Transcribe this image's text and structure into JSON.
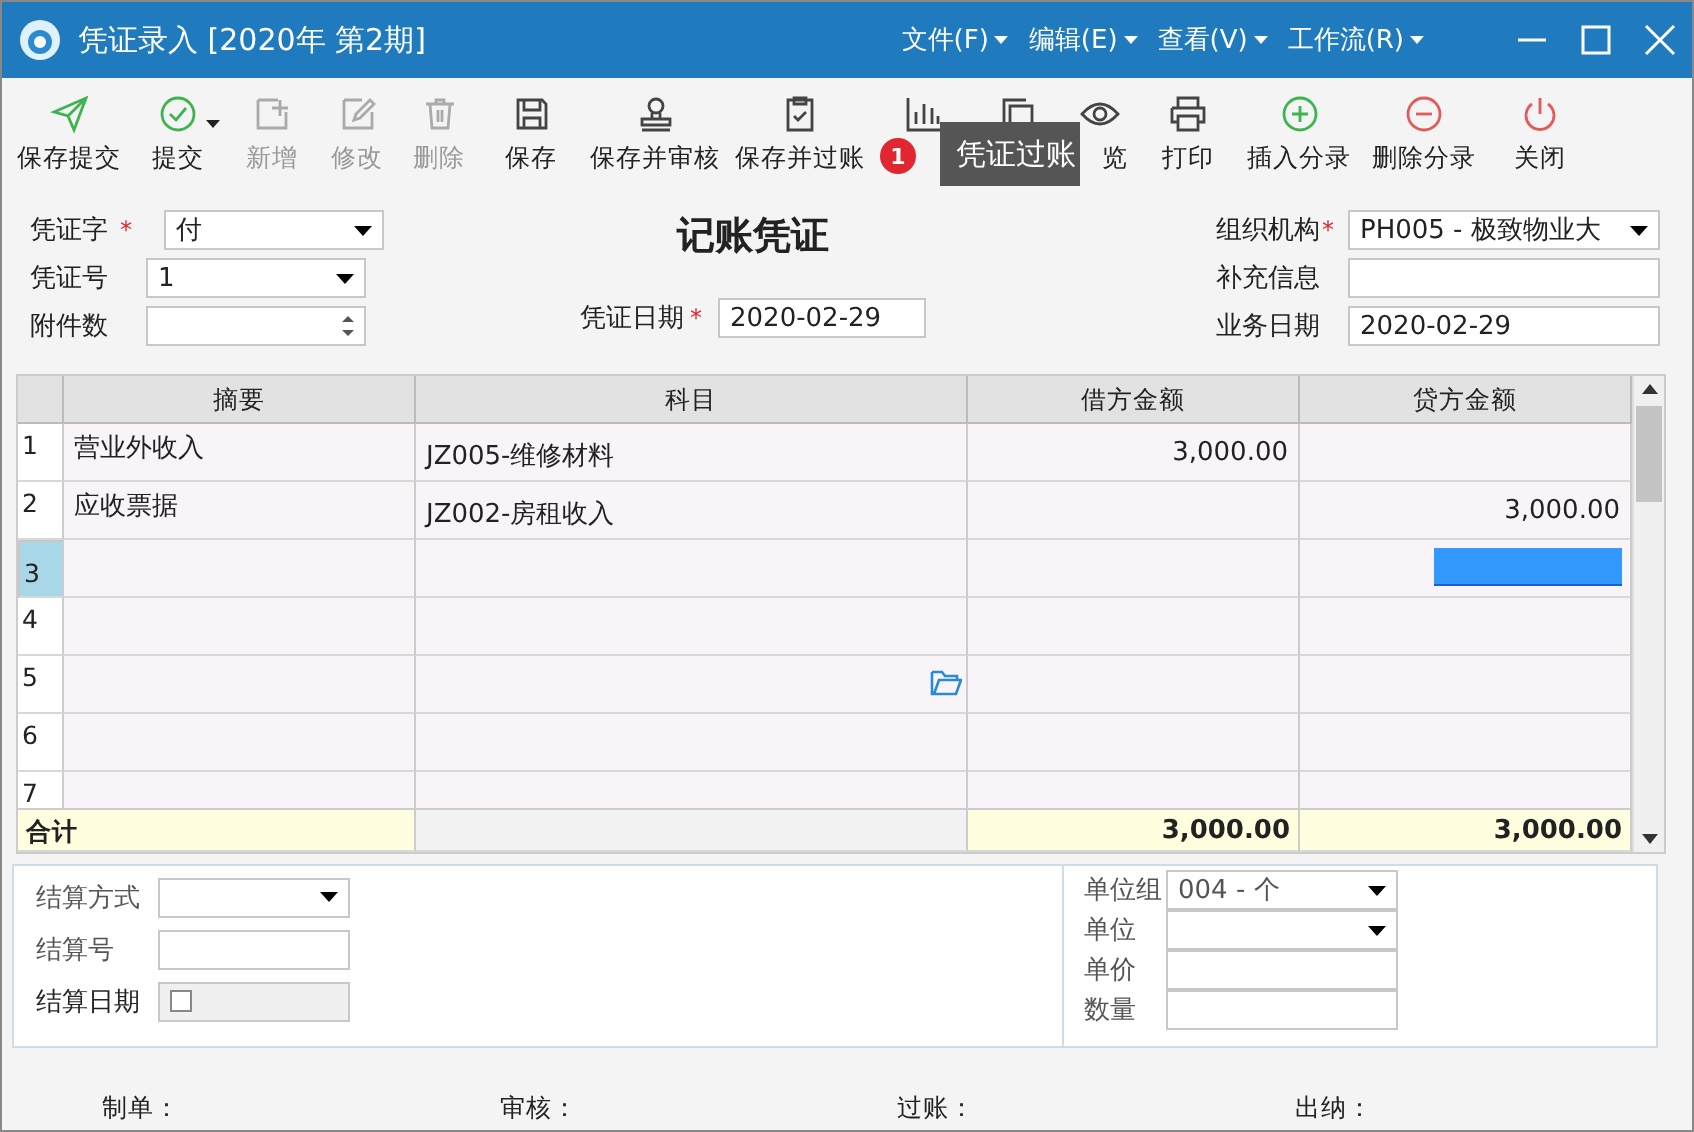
{
  "window": {
    "title": "凭证录入 [2020年 第2期]"
  },
  "menu": [
    {
      "label": "文件(F)"
    },
    {
      "label": "编辑(E)"
    },
    {
      "label": "查看(V)"
    },
    {
      "label": "工作流(R)"
    }
  ],
  "toolbar": [
    {
      "label": "保存提交",
      "disabled": false,
      "has_menu": false
    },
    {
      "label": "提交",
      "disabled": false,
      "has_menu": true
    },
    {
      "label": "新增",
      "disabled": true,
      "has_menu": false
    },
    {
      "label": "修改",
      "disabled": true,
      "has_menu": false
    },
    {
      "label": "删除",
      "disabled": true,
      "has_menu": false
    },
    {
      "label": "保存",
      "disabled": false,
      "has_menu": false
    },
    {
      "label": "保存并审核",
      "disabled": false,
      "has_menu": false
    },
    {
      "label": "保存并过账",
      "disabled": false,
      "has_menu": false
    },
    {
      "disabled": false,
      "has_menu": false
    },
    {
      "disabled": false,
      "has_menu": false
    },
    {
      "label": "览",
      "disabled": false,
      "has_menu": false
    },
    {
      "label": "打印",
      "disabled": false,
      "has_menu": false
    },
    {
      "label": "插入分录",
      "disabled": false,
      "has_menu": false
    },
    {
      "label": "删除分录",
      "disabled": false,
      "has_menu": false
    },
    {
      "label": "关闭",
      "disabled": false,
      "has_menu": false
    }
  ],
  "tooltip": {
    "badge": "1",
    "text": "凭证过账"
  },
  "form": {
    "title": "记账凭证",
    "voucher_type": {
      "label": "凭证字",
      "marker": "*",
      "value": "付"
    },
    "voucher_no": {
      "label": "凭证号",
      "value": "1"
    },
    "attachments": {
      "label": "附件数"
    },
    "voucher_date": {
      "label": "凭证日期",
      "marker": "*",
      "value": "2020-02-29"
    },
    "org": {
      "label": "组织机构",
      "marker": "*",
      "value": "PH005 - 极致物业大"
    },
    "extra": {
      "label": "补充信息"
    },
    "business_date": {
      "label": "业务日期",
      "value": "2020-02-29"
    }
  },
  "table": {
    "columns": [
      "摘要",
      "科目",
      "借方金额",
      "贷方金额"
    ],
    "rows": [
      {
        "no": "1",
        "summary": "营业外收入",
        "account": "JZ005-维修材料",
        "debit": "3,000.00",
        "credit": "",
        "selected": false,
        "lookup": false
      },
      {
        "no": "2",
        "summary": "应收票据",
        "account": "JZ002-房租收入",
        "debit": "",
        "credit": "3,000.00",
        "selected": false,
        "lookup": false
      },
      {
        "no": "3",
        "summary": "",
        "account": "",
        "debit": "",
        "credit": "",
        "selected": true,
        "lookup": false
      },
      {
        "no": "4",
        "summary": "",
        "account": "",
        "debit": "",
        "credit": "",
        "selected": false,
        "lookup": false
      },
      {
        "no": "5",
        "summary": "",
        "account": "",
        "debit": "",
        "credit": "",
        "selected": false,
        "lookup": true
      },
      {
        "no": "6",
        "summary": "",
        "account": "",
        "debit": "",
        "credit": "",
        "selected": false,
        "lookup": false
      },
      {
        "no": "7",
        "summary": "",
        "account": "",
        "debit": "",
        "credit": "",
        "selected": false,
        "lookup": false
      }
    ],
    "total": {
      "label": "合计",
      "debit": "3,000.00",
      "credit": "3,000.00"
    }
  },
  "settlement": {
    "method": {
      "label": "结算方式"
    },
    "number": {
      "label": "结算号"
    },
    "date": {
      "label": "结算日期",
      "checked": false
    }
  },
  "units": {
    "group": {
      "label": "单位组",
      "value": "004 - 个"
    },
    "unit": {
      "label": "单位"
    },
    "price": {
      "label": "单价"
    },
    "quantity": {
      "label": "数量"
    }
  },
  "signatures": [
    {
      "label": "制单："
    },
    {
      "label": "审核："
    },
    {
      "label": "过账："
    },
    {
      "label": "出纳："
    }
  ]
}
